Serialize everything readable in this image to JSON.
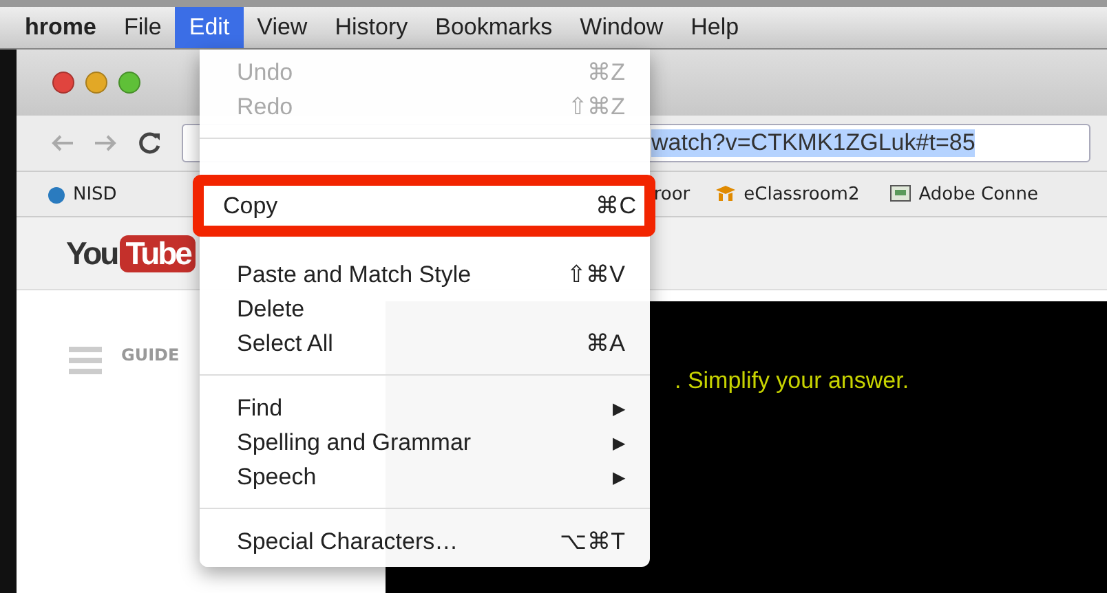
{
  "menu_bar": [
    {
      "label": "hrome",
      "selected": false
    },
    {
      "label": "File",
      "selected": false
    },
    {
      "label": "Edit",
      "selected": true
    },
    {
      "label": "View",
      "selected": false
    },
    {
      "label": "History",
      "selected": false
    },
    {
      "label": "Bookmarks",
      "selected": false
    },
    {
      "label": "Window",
      "selected": false
    },
    {
      "label": "Help",
      "selected": false
    }
  ],
  "address_bar": {
    "value": "watch?v=CTKMK1ZGLuk#t=85"
  },
  "bookmarks": [
    {
      "label": "NISD",
      "kind": "drop"
    },
    {
      "label": "roor",
      "kind": "none"
    },
    {
      "label": "eClassroom2",
      "kind": "cap"
    },
    {
      "label": "Adobe Conne",
      "kind": "board"
    }
  ],
  "youtube_logo": {
    "left": "You",
    "right": "Tube"
  },
  "guide": {
    "label": "GUIDE"
  },
  "video": {
    "caption": ". Simplify your answer."
  },
  "edit_menu": [
    {
      "kind": "item",
      "label": "Undo",
      "shortcut": "⌘Z",
      "disabled": true,
      "highlighted": false
    },
    {
      "kind": "item",
      "label": "Redo",
      "shortcut": "⇧⌘Z",
      "disabled": true,
      "highlighted": false
    },
    {
      "kind": "separator"
    },
    {
      "kind": "hidden"
    },
    {
      "kind": "item",
      "label": "Copy",
      "shortcut": "⌘C",
      "disabled": false,
      "highlighted": true
    },
    {
      "kind": "hidden"
    },
    {
      "kind": "item",
      "label": "Paste and Match Style",
      "shortcut": "⇧⌘V",
      "disabled": false,
      "highlighted": false
    },
    {
      "kind": "item",
      "label": "Delete",
      "disabled": false,
      "highlighted": false
    },
    {
      "kind": "item",
      "label": "Select All",
      "shortcut": "⌘A",
      "disabled": false,
      "highlighted": false
    },
    {
      "kind": "separator"
    },
    {
      "kind": "submenu",
      "label": "Find",
      "arrow": "▶"
    },
    {
      "kind": "submenu",
      "label": "Spelling and Grammar",
      "arrow": "▶"
    },
    {
      "kind": "submenu",
      "label": "Speech",
      "arrow": "▶"
    },
    {
      "kind": "separator"
    },
    {
      "kind": "item",
      "label": "Special Characters…",
      "shortcut": "⌥⌘T",
      "disabled": false,
      "highlighted": false
    }
  ]
}
